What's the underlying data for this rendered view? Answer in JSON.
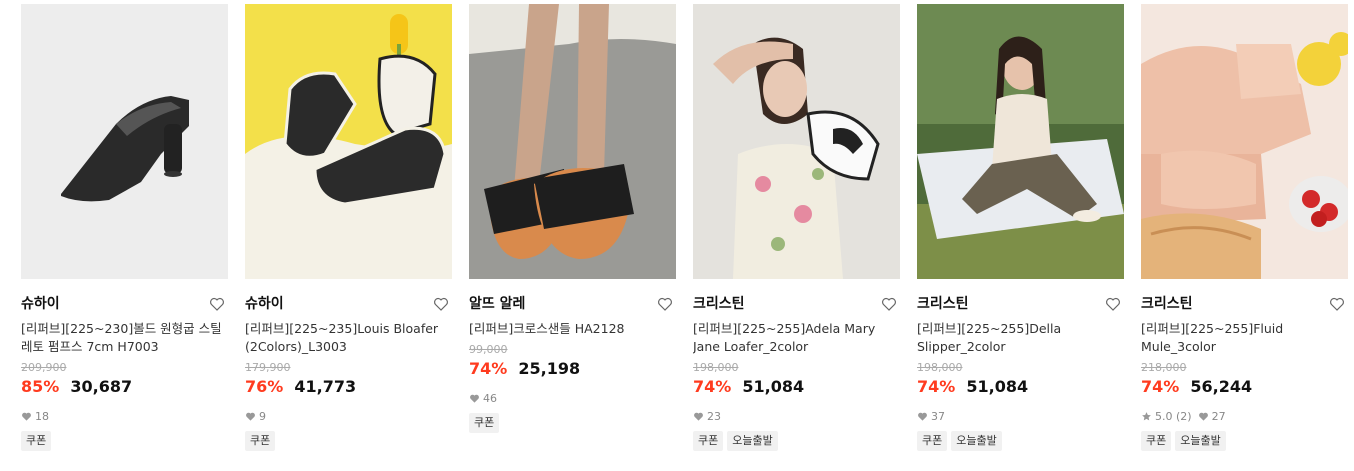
{
  "products": [
    {
      "brand": "슈하이",
      "name": "[리퍼브][225~230]볼드 원형굽 스틸레토 펌프스 7cm H7003",
      "original_price": "209,900",
      "discount": "85%",
      "price": "30,687",
      "likes": "18",
      "rating": "",
      "tags": [
        "쿠폰"
      ]
    },
    {
      "brand": "슈하이",
      "name": "[리퍼브][225~235]Louis Bloafer (2Colors)_L3003",
      "original_price": "179,900",
      "discount": "76%",
      "price": "41,773",
      "likes": "9",
      "rating": "",
      "tags": [
        "쿠폰"
      ]
    },
    {
      "brand": "알뜨 알레",
      "name": "[리퍼브]크로스샌들 HA2128",
      "original_price": "99,000",
      "discount": "74%",
      "price": "25,198",
      "likes": "46",
      "rating": "",
      "tags": [
        "쿠폰"
      ]
    },
    {
      "brand": "크리스틴",
      "name": "[리퍼브][225~255]Adela Mary Jane Loafer_2color",
      "original_price": "198,000",
      "discount": "74%",
      "price": "51,084",
      "likes": "23",
      "rating": "",
      "tags": [
        "쿠폰",
        "오늘출발"
      ]
    },
    {
      "brand": "크리스틴",
      "name": "[리퍼브][225~255]Della Slipper_2color",
      "original_price": "198,000",
      "discount": "74%",
      "price": "51,084",
      "likes": "37",
      "rating": "",
      "tags": [
        "쿠폰",
        "오늘출발"
      ]
    },
    {
      "brand": "크리스틴",
      "name": "[리퍼브][225~255]Fluid Mule_3color",
      "original_price": "218,000",
      "discount": "74%",
      "price": "56,244",
      "likes": "27",
      "rating": "5.0 (2)",
      "tags": [
        "쿠폰",
        "오늘출발"
      ]
    }
  ],
  "icons": {
    "wishlist": "heart-outline-icon",
    "likes": "heart-filled-icon",
    "rating": "star-icon"
  },
  "colors": {
    "discount": "#ff3b1f",
    "price": "#111111",
    "original_price": "#aaaaaa"
  }
}
